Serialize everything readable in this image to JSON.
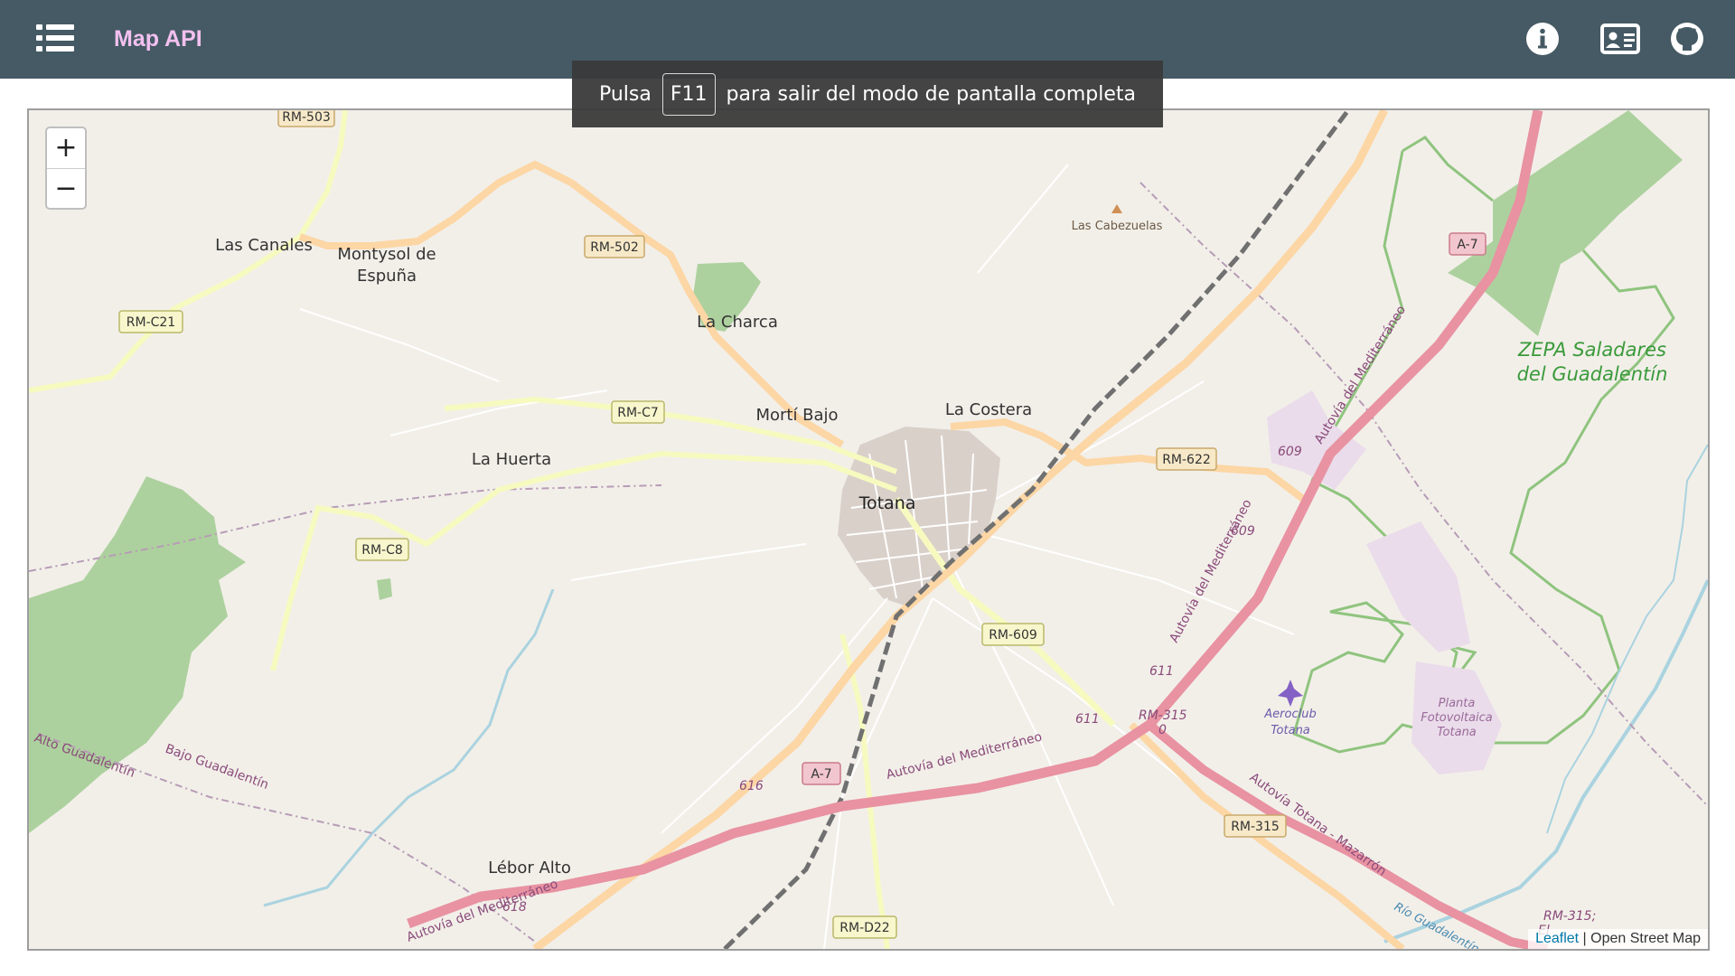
{
  "app": {
    "title": "Map API"
  },
  "header": {
    "menu_icon": "list-menu-icon",
    "info_icon": "info-circle-icon",
    "contact_icon": "contact-card-icon",
    "github_icon": "github-icon"
  },
  "fullscreen_notice": {
    "before": "Pulsa",
    "key": "F11",
    "after": "para salir del modo de pantalla completa"
  },
  "map": {
    "zoom_in": "+",
    "zoom_out": "−",
    "attribution": {
      "leaflet": "Leaflet",
      "separator": " | ",
      "osm": "Open Street Map"
    },
    "places": {
      "totana": "Totana",
      "las_canales": "Las Canales",
      "montysol_1": "Montysol de",
      "montysol_2": "Espuña",
      "la_charca": "La Charca",
      "morti_bajo": "Mortí Bajo",
      "la_costera": "La Costera",
      "la_huerta": "La Huerta",
      "lebor_alto": "Lébor Alto",
      "las_cabezuelas": "Las Cabezuelas",
      "zepa_1": "ZEPA Saladares",
      "zepa_2": "del Guadalentín",
      "aeroclub_1": "Aeroclub",
      "aeroclub_2": "Totana",
      "planta_1": "Planta",
      "planta_2": "Fotovoltaica",
      "planta_3": "Totana",
      "alto_guadalentin": "Alto Guadalentín",
      "bajo_guadalentin": "Bajo Guadalentín",
      "rio_guadalentin": "Río Guadalentín"
    },
    "road_shields": {
      "rm503": "RM-503",
      "rm502": "RM-502",
      "rmc21": "RM-C21",
      "rmc7": "RM-C7",
      "rmc8": "RM-C8",
      "a7_top": "A-7",
      "a7_bottom": "A-7",
      "rm622": "RM-622",
      "rm609": "RM-609",
      "rm315": "RM-315",
      "rmd22": "RM-D22"
    },
    "road_labels": {
      "autovia_1": "Autovía del Mediterráneo",
      "autovia_2": "Autovía del Mediterráneo",
      "autovia_3": "Autovía del Mediterráneo",
      "autovia_4": "Autovía del Mediterráneo",
      "autovia_mazarron": "Autovía Totana - Mazarrón",
      "km609a": "609",
      "km609b": "609",
      "km611a": "611",
      "km611b": "611",
      "km616": "616",
      "km618": "618",
      "rm315_label": "RM-315",
      "rm315_zero": "0",
      "rm315_el_1": "RM-315;",
      "rm315_el_2": "El"
    }
  },
  "colors": {
    "topbar": "#455a64",
    "title": "#f3c0ef",
    "map_background": "#f2efe9",
    "motorway": "#e892a2",
    "primary_road": "#fcd6a4",
    "secondary_road": "#f7fabf",
    "forest": "#add19e",
    "water": "#aad3df"
  }
}
